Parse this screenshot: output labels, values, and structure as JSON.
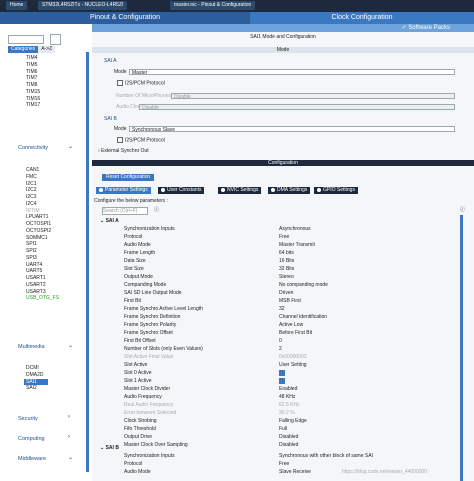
{
  "topbar": {
    "home": "Home",
    "chip": "STM32L4R5ZITx - NUCLEO-L4R5ZI",
    "project": "master.ioc - Pinout & Configuration"
  },
  "tabs": {
    "pinout": "Pinout & Configuration",
    "clock": "Clock Configuration"
  },
  "software_packs": "✓ Software Packs",
  "left": {
    "category_tab": "Categories",
    "az_tab": "A->Z",
    "timers": [
      "TIM4",
      "TIM5",
      "TIM6",
      "TIM7",
      "TIM8",
      "TIM15",
      "TIM16",
      "TIM17"
    ],
    "connectivity": "Connectivity",
    "conn_items": [
      "CAN1",
      "FMC",
      "I2C1",
      "I2C2",
      "I2C3",
      "I2C4",
      "IRTIM",
      "LPUART1",
      "OCTOSPI1",
      "OCTOSPI2",
      "SDMMC1",
      "SPI1",
      "SPI2",
      "SPI3",
      "UART4",
      "UART5",
      "USART1",
      "USART2",
      "USART3",
      "USB_OTG_FS"
    ],
    "multimedia": "Multimedia",
    "mm_items": [
      "DCMI",
      "DMA2D",
      "SAI1",
      "SAI2"
    ],
    "security": "Security",
    "computing": "Computing",
    "middleware": "Middleware"
  },
  "mode": {
    "title": "SAI1 Mode and Configuration",
    "header": "Mode",
    "sai_a": "SAI A",
    "mode_label": "Mode",
    "mode_a": "Master",
    "i2s_a": "I2S/PCM Protocol",
    "num_mic": "Number Of MicroPhones",
    "num_mic_val": "Disable",
    "audio_clock": "Audio Clock",
    "audio_clock_val": "Disable",
    "sai_b": "SAI B",
    "mode_b": "Synchronous Slave",
    "i2s_b": "I2S/PCM Protocol",
    "ext_sync": "External Synchro Out"
  },
  "config": {
    "header": "Configuration",
    "reset": "Reset Configuration",
    "ptabs": [
      "Parameter Settings",
      "User Constants",
      "NVIC Settings",
      "DMA Settings",
      "GPIO Settings"
    ],
    "configure_text": "Configure the below parameters :",
    "search_placeholder": "Search (Ctrl+F)",
    "group_a": "SAI A",
    "params_a": [
      [
        "Synchronization Inputs",
        "Asynchronous"
      ],
      [
        "Protocol",
        "Free"
      ],
      [
        "Audio Mode",
        "Master Transmit"
      ],
      [
        "Frame Length",
        "64 bits"
      ],
      [
        "Data Size",
        "16 Bits"
      ],
      [
        "Slot Size",
        "32 Bits"
      ],
      [
        "Output Mode",
        "Stereo"
      ],
      [
        "Companding Mode",
        "No companding mode"
      ],
      [
        "SAI SD Line Output Mode",
        "Driven"
      ],
      [
        "First Bit",
        "MSB First"
      ],
      [
        "Frame Synchro Active Level Length",
        "32"
      ],
      [
        "Frame Synchro Definition",
        "Channel Identification"
      ],
      [
        "Frame Synchro Polarity",
        "Active Low"
      ],
      [
        "Frame Synchro Offset",
        "Before First Bit"
      ],
      [
        "First Bit Offset",
        "0"
      ],
      [
        "Number of Slots (only Even Values)",
        "2"
      ],
      [
        "Slot Active Final Value",
        "0x00000003"
      ],
      [
        "Slot Active",
        "User Setting"
      ],
      [
        "Slot 0 Active",
        "✓"
      ],
      [
        "Slot 1 Active",
        "✓"
      ],
      [
        "Master Clock Divider",
        "Enabled"
      ],
      [
        "Audio Frequency",
        "48 KHz"
      ],
      [
        "Real Audio Frequency",
        "62.5 KHz"
      ],
      [
        "Error between Selected",
        "30.2 %"
      ],
      [
        "Clock Strobing",
        "Falling Edge"
      ],
      [
        "Fifo Threshold",
        "Full"
      ],
      [
        "Output Drive",
        "Disabled"
      ],
      [
        "Master Clock Over Sampling",
        "Disabled"
      ]
    ],
    "group_b": "SAI B",
    "params_b": [
      [
        "Synchronization Inputs",
        "Synchronous with other block of same SAI"
      ],
      [
        "Protocol",
        "Free"
      ],
      [
        "Audio Mode",
        "Slave Receive"
      ]
    ]
  },
  "watermark": "https://blog.csdn.net/weixin_44000000"
}
